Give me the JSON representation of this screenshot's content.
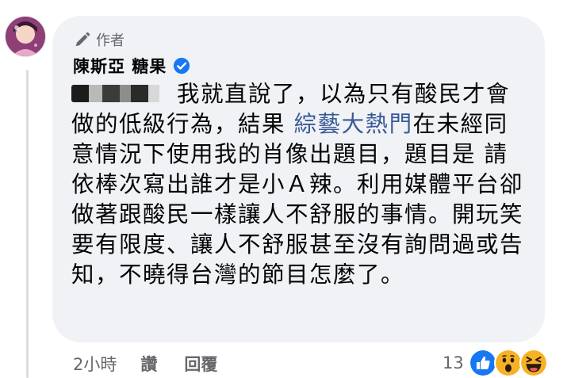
{
  "comment": {
    "author_badge": "作者",
    "author_name": "陳斯亞 糖果",
    "text_before_link": "我就直說了，以為只有酸民才會做的低級行為，結果 ",
    "link_text": "綜藝大熱門",
    "text_after_link": "在未經同意情況下使用我的肖像出題目，題目是 請依棒次寫出誰才是小Ａ辣。利用媒體平台卻做著跟酸民一樣讓人不舒服的事情。開玩笑要有限度、讓人不舒服甚至沒有詢問過或告知，不曉得台灣的節目怎麼了。"
  },
  "actions": {
    "timestamp": "2小時",
    "like_label": "讚",
    "reply_label": "回覆"
  },
  "reactions": {
    "count": "13",
    "icons": [
      "like-icon",
      "wow-icon",
      "haha-icon"
    ]
  },
  "colors": {
    "bubble_bg": "#f0f2f5",
    "link": "#385898",
    "verified": "#1877f2",
    "meta_text": "#65676b"
  }
}
